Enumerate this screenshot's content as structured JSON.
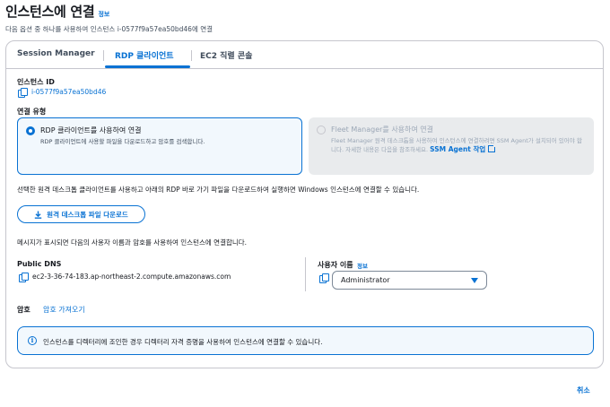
{
  "header": {
    "title": "인스턴스에 연결",
    "info_link": "정보",
    "subtitle": "다음 옵션 중 하나를 사용하여 인스턴스 i-0577f9a57ea50bd46에 연결"
  },
  "tabs": [
    {
      "label": "Session Manager",
      "active": false
    },
    {
      "label": "RDP 클라이언트",
      "active": true
    },
    {
      "label": "EC2 직렬 콘솔",
      "active": false
    }
  ],
  "instance": {
    "label": "인스턴스 ID",
    "id": "i-0577f9a57ea50bd46"
  },
  "connection_type": {
    "label": "연결 유형",
    "options": [
      {
        "title": "RDP 클라이언트를 사용하여 연결",
        "description": "RDP 클라이언트에 사용할 파일을 다운로드하고 암호를 검색합니다.",
        "selected": true,
        "disabled": false
      },
      {
        "title": "Fleet Manager를 사용하여 연결",
        "description": "Fleet Manager 원격 데스크톱을 사용하여 인스턴스에 연결하려면 SSM Agent가 설치되어 있어야 합니다. 자세한 내용은 다음을 참조하세요.",
        "link": "SSM Agent 작업",
        "selected": false,
        "disabled": true
      }
    ]
  },
  "rdp": {
    "instructions": "선택한 원격 데스크톱 클라이언트를 사용하고 아래의 RDP 바로 가기 파일을 다운로드하여 실행하면 Windows 인스턴스에 연결할 수 있습니다.",
    "download_button": "원격 데스크톱 파일 다운로드",
    "prompt_text": "메시지가 표시되면 다음의 사용자 이름과 암호를 사용하여 인스턴스에 연결합니다."
  },
  "public_dns": {
    "label": "Public DNS",
    "value": "ec2-3-36-74-183.ap-northeast-2.compute.amazonaws.com"
  },
  "username": {
    "label": "사용자 이름",
    "info_link": "정보",
    "selected": "Administrator"
  },
  "password": {
    "label": "암호",
    "link": "암호 가져오기"
  },
  "alert": {
    "text": "인스턴스를 디렉터리에 조인한 경우 디렉터리 자격 증명을 사용하여 인스턴스에 연결할 수 있습니다."
  },
  "footer": {
    "cancel": "취소"
  },
  "colors": {
    "accent": "#0972d3",
    "text": "#16191f",
    "border": "#c6c6cd",
    "selected_bg": "#f2f8fd",
    "disabled_bg": "#e9ebed"
  }
}
